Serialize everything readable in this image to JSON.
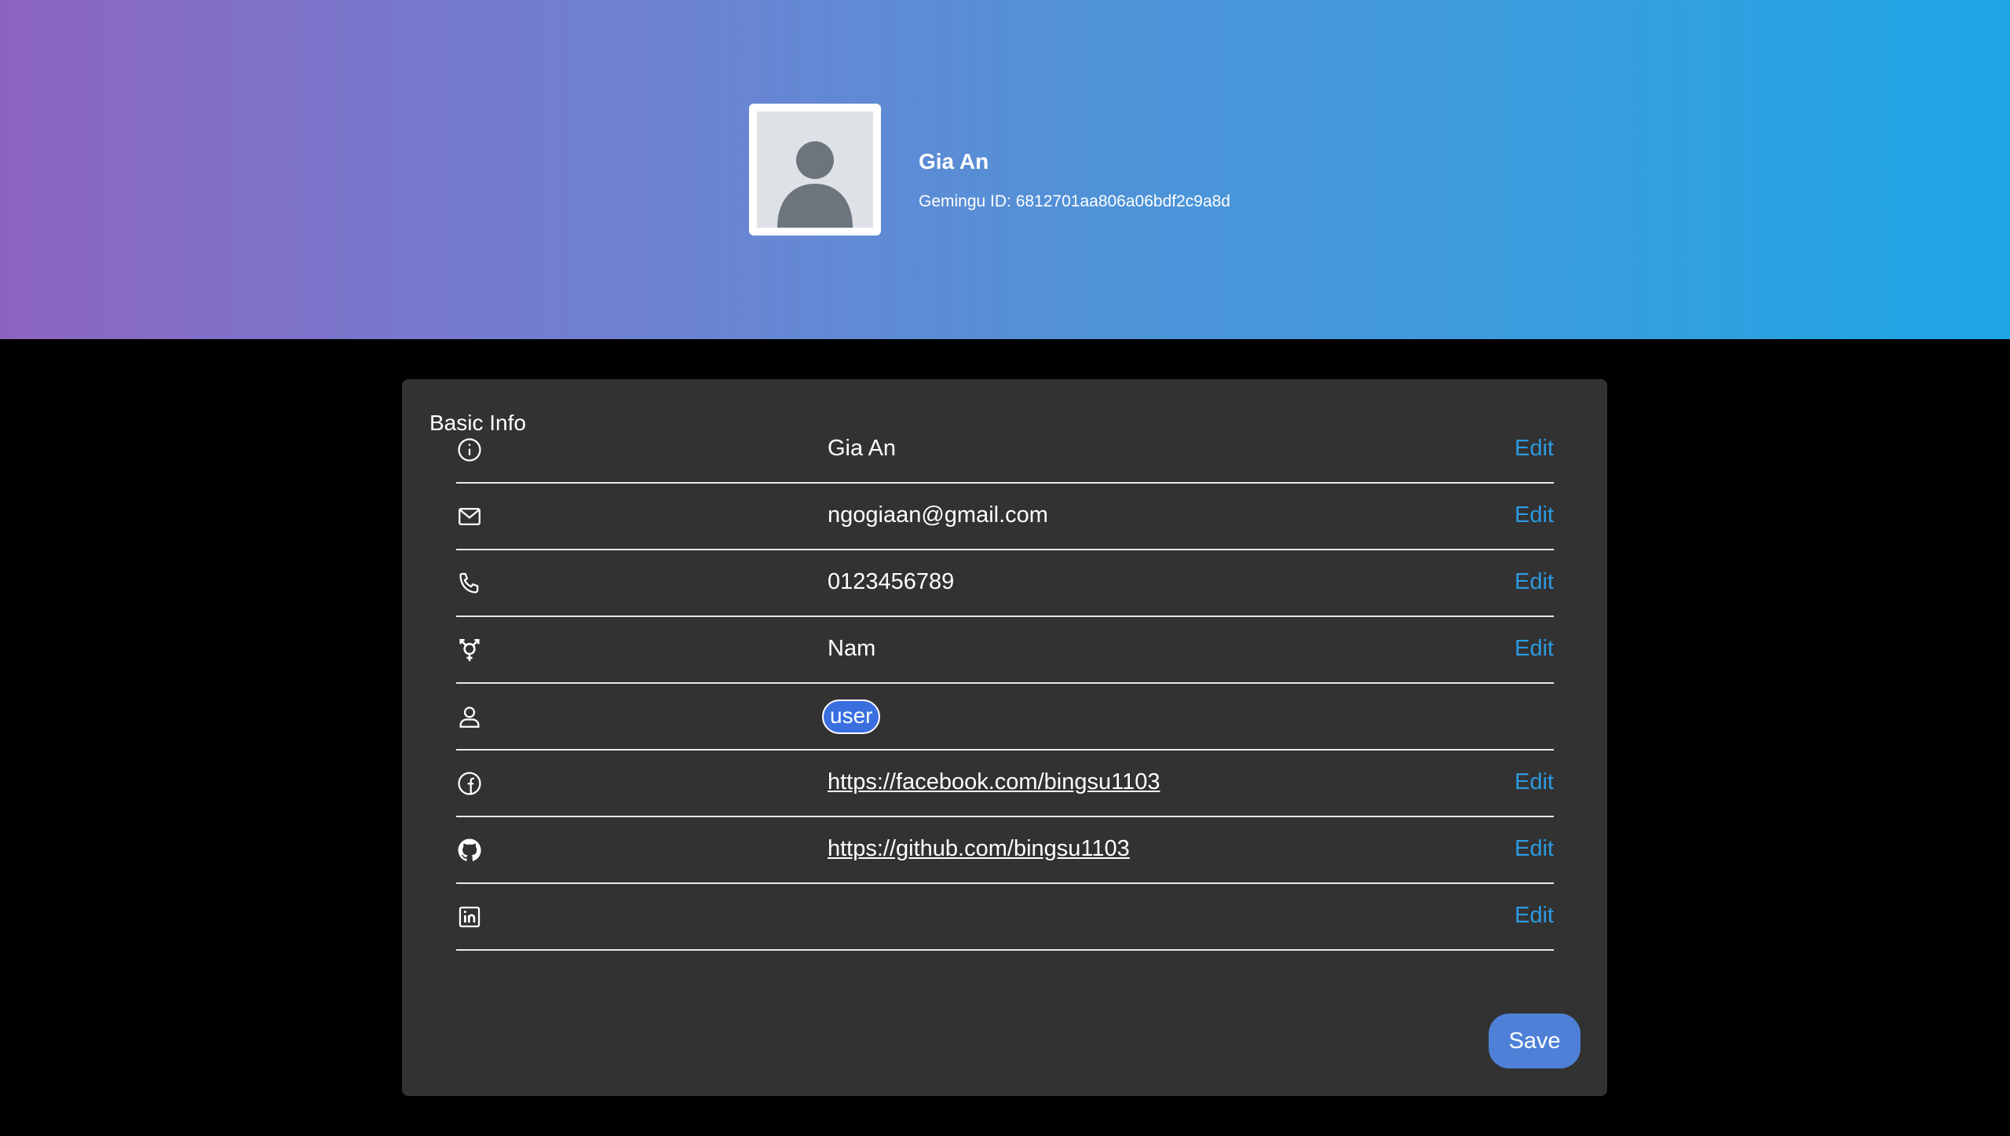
{
  "profile": {
    "name": "Gia An",
    "id_text": "Gemingu ID: 6812701aa806a06bdf2c9a8d"
  },
  "basic_info": {
    "title": "Basic Info",
    "edit_label": "Edit",
    "rows": [
      {
        "icon": "info-icon",
        "value": "Gia An",
        "editable": true
      },
      {
        "icon": "mail-icon",
        "value": "ngogiaan@gmail.com",
        "editable": true
      },
      {
        "icon": "phone-icon",
        "value": "0123456789",
        "editable": true
      },
      {
        "icon": "gender-icon",
        "value": "Nam",
        "editable": true
      },
      {
        "icon": "user-icon",
        "value": "user",
        "editable": false,
        "badge": true
      },
      {
        "icon": "facebook-icon",
        "value": "https://facebook.com/bingsu1103",
        "editable": true,
        "link": true
      },
      {
        "icon": "github-icon",
        "value": "https://github.com/bingsu1103",
        "editable": true,
        "link": true
      },
      {
        "icon": "linkedin-icon",
        "value": "",
        "editable": true
      }
    ],
    "save_label": "Save"
  },
  "colors": {
    "accent_link": "#2d9ae0",
    "save_button": "#4f80d8",
    "badge": "#3a6fe0",
    "card_bg": "#323232"
  }
}
